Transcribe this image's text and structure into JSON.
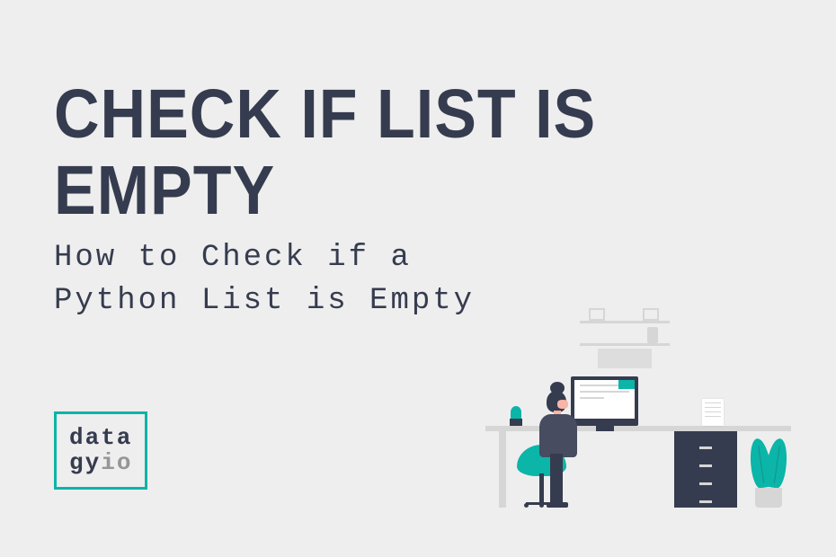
{
  "title": "Check if List is Empty",
  "subtitle_line1": "How to Check if a",
  "subtitle_line2": "Python List is Empty",
  "logo": {
    "line1": "data",
    "line2_part1": "gy",
    "line2_part2": "io"
  },
  "colors": {
    "background": "#eeeeee",
    "text_dark": "#363c4f",
    "accent_teal": "#0bb5a8",
    "text_gray": "#969696",
    "light_gray": "#d6d6d6"
  }
}
